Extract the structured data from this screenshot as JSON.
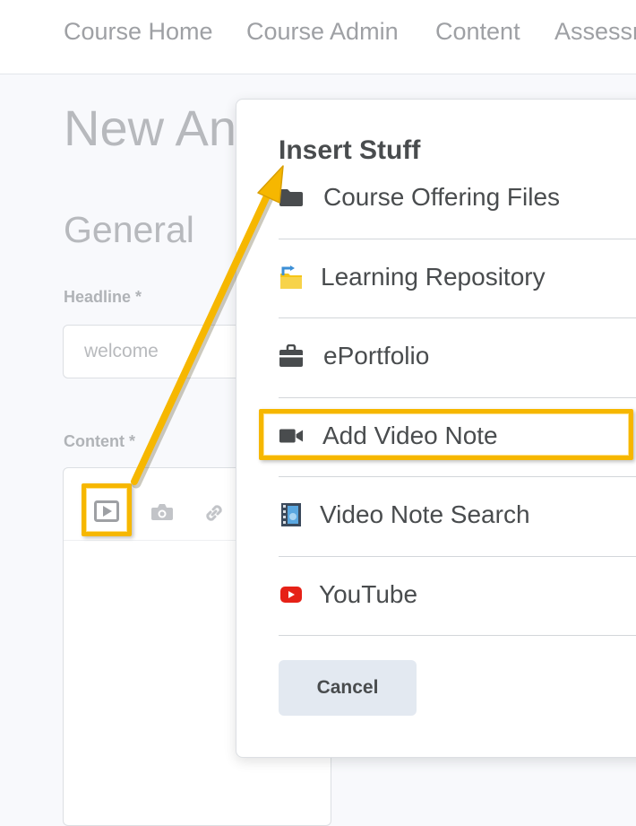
{
  "topnav": {
    "links": [
      {
        "label": "Course Home"
      },
      {
        "label": "Course Admin"
      },
      {
        "label": "Content"
      },
      {
        "label": "Assessm"
      }
    ]
  },
  "page": {
    "title": "New An",
    "section_title": "General",
    "headline_label": "Headline *",
    "headline_value": "welcome",
    "content_label": "Content *"
  },
  "editor_toolbar": {
    "icons": [
      "video-icon",
      "camera-icon",
      "link-icon"
    ]
  },
  "dialog": {
    "title": "Insert Stuff",
    "items": [
      {
        "label": "Course Offering Files",
        "icon": "folder-icon"
      },
      {
        "label": "Learning Repository",
        "icon": "repository-icon"
      },
      {
        "label": "ePortfolio",
        "icon": "briefcase-icon"
      },
      {
        "label": "Add Video Note",
        "icon": "video-camera-icon"
      },
      {
        "label": "Video Note Search",
        "icon": "film-icon"
      },
      {
        "label": "YouTube",
        "icon": "youtube-icon"
      }
    ],
    "cancel_label": "Cancel"
  },
  "colors": {
    "annotation": "#f6b700",
    "youtube_red": "#e62117",
    "repository_yellow": "#f5c518",
    "repository_blue": "#3c8fd6"
  }
}
